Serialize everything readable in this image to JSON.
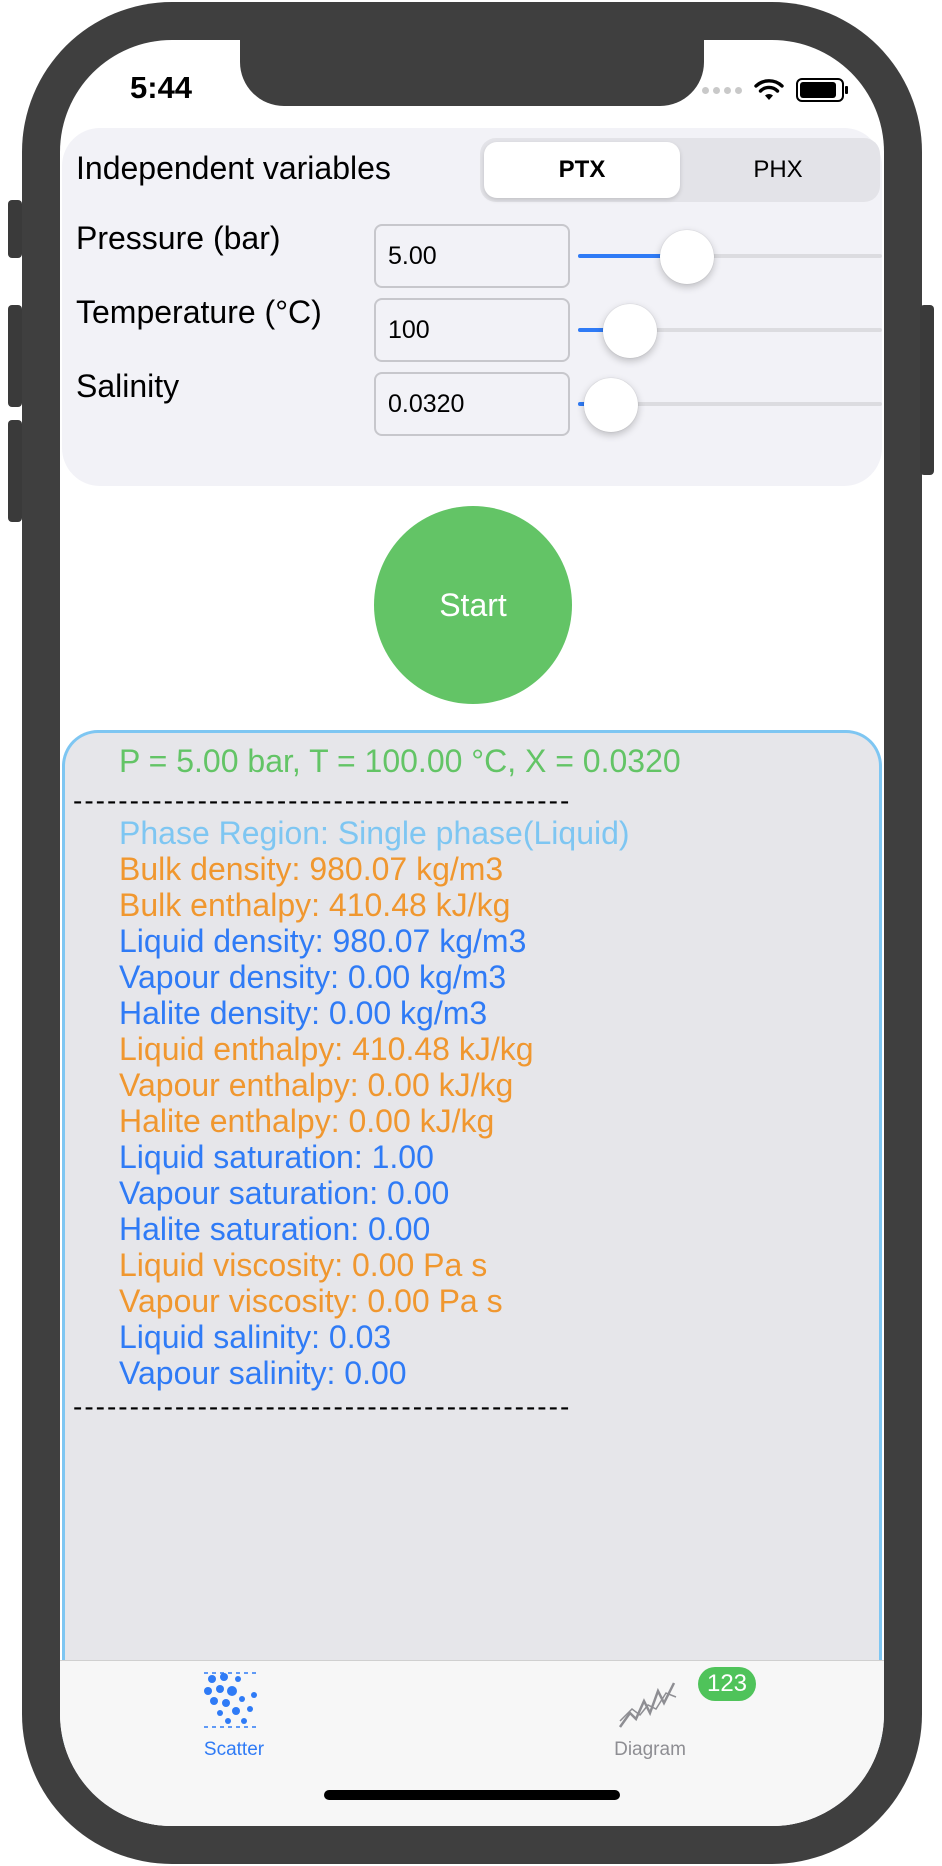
{
  "status": {
    "time": "5:44"
  },
  "controls": {
    "independent_label": "Independent variables",
    "segments": [
      "PTX",
      "PHX"
    ],
    "selected_segment": "PTX",
    "pressure": {
      "label": "Pressure (bar)",
      "value": "5.00",
      "slider_fraction": 0.36
    },
    "temperature": {
      "label": "Temperature (°C)",
      "value": "100",
      "slider_fraction": 0.17
    },
    "salinity": {
      "label": "Salinity",
      "value": "0.0320",
      "slider_fraction": 0.11
    }
  },
  "start_button": {
    "label": "Start",
    "color": "#63c466"
  },
  "results": {
    "header": "P = 5.00 bar, T = 100.00 °C, X = 0.0320",
    "separator": "--------------------------------------------",
    "phase": "Phase Region: Single phase(Liquid)",
    "lines": [
      {
        "text": "Bulk density: 980.07 kg/m3",
        "color": "#f0972f"
      },
      {
        "text": "Bulk enthalpy: 410.48 kJ/kg",
        "color": "#f0972f"
      },
      {
        "text": "Liquid density: 980.07 kg/m3",
        "color": "#2f7bf6"
      },
      {
        "text": "Vapour density: 0.00 kg/m3",
        "color": "#2f7bf6"
      },
      {
        "text": "Halite density: 0.00 kg/m3",
        "color": "#2f7bf6"
      },
      {
        "text": "Liquid enthalpy: 410.48 kJ/kg",
        "color": "#f0972f"
      },
      {
        "text": "Vapour enthalpy: 0.00 kJ/kg",
        "color": "#f0972f"
      },
      {
        "text": "Halite enthalpy: 0.00 kJ/kg",
        "color": "#f0972f"
      },
      {
        "text": "Liquid saturation: 1.00",
        "color": "#2f7bf6"
      },
      {
        "text": "Vapour saturation: 0.00",
        "color": "#2f7bf6"
      },
      {
        "text": "Halite saturation: 0.00",
        "color": "#2f7bf6"
      },
      {
        "text": "Liquid viscosity: 0.00 Pa s",
        "color": "#f0972f"
      },
      {
        "text": "Vapour viscosity: 0.00 Pa s",
        "color": "#f0972f"
      },
      {
        "text": "Liquid salinity: 0.03",
        "color": "#2f7bf6"
      },
      {
        "text": "Vapour salinity: 0.00",
        "color": "#2f7bf6"
      }
    ],
    "colors": {
      "header": "#63c466",
      "phase": "#7ec6f2"
    }
  },
  "tabbar": {
    "tabs": [
      {
        "label": "Scatter",
        "icon": "scatter-icon",
        "active": true
      },
      {
        "label": "Diagram",
        "icon": "diagram-icon",
        "active": false
      }
    ],
    "badge": "123",
    "active_color": "#2f7bf6",
    "inactive_color": "#8e8e93"
  }
}
